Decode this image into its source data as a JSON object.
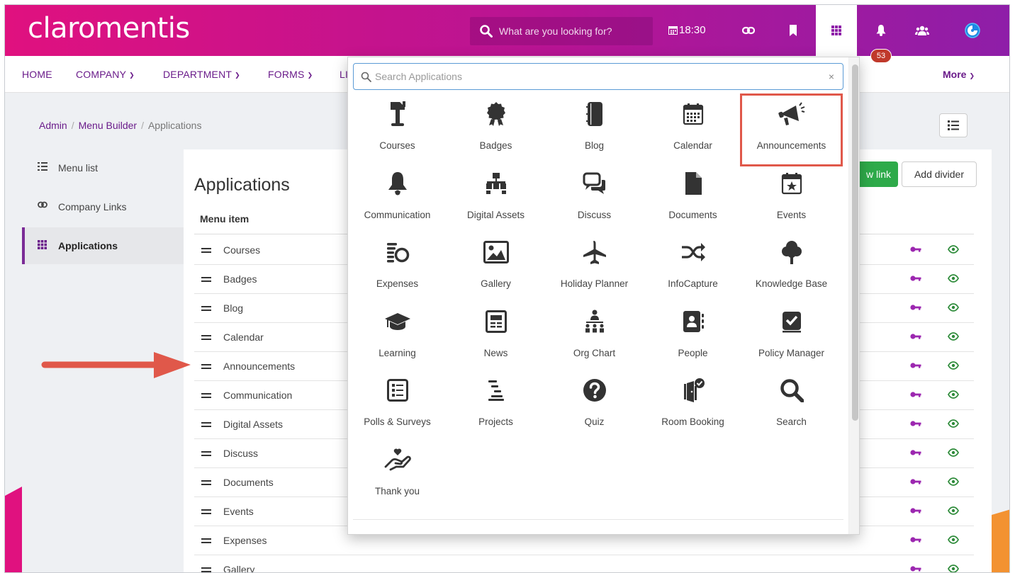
{
  "logo": "claromentis",
  "global_search": {
    "placeholder": "What are you looking for?"
  },
  "clock": "18:30",
  "notification_count": "53",
  "nav": {
    "items": [
      "HOME",
      "COMPANY",
      "DEPARTMENT",
      "FORMS",
      "LI"
    ],
    "more": "More"
  },
  "breadcrumb": [
    "Admin",
    "Menu Builder",
    "Applications"
  ],
  "sidebar": {
    "items": [
      {
        "label": "Menu list",
        "icon": "list-icon"
      },
      {
        "label": "Company Links",
        "icon": "link-icon"
      },
      {
        "label": "Applications",
        "icon": "grid-icon",
        "active": true
      }
    ]
  },
  "main": {
    "title": "Applications",
    "column_header": "Menu item",
    "new_link_label": "w link",
    "add_divider_label": "Add divider",
    "rows": [
      "Courses",
      "Badges",
      "Blog",
      "Calendar",
      "Announcements",
      "Communication",
      "Digital Assets",
      "Discuss",
      "Documents",
      "Events",
      "Expenses",
      "Gallery"
    ]
  },
  "dropdown": {
    "search_placeholder": "Search Applications",
    "clear": "×",
    "apps": [
      {
        "label": "Courses",
        "icon": "lectern-icon"
      },
      {
        "label": "Badges",
        "icon": "award-icon"
      },
      {
        "label": "Blog",
        "icon": "notebook-icon"
      },
      {
        "label": "Calendar",
        "icon": "calendar-icon"
      },
      {
        "label": "Announcements",
        "icon": "megaphone-icon",
        "highlighted": true
      },
      {
        "label": "Communication",
        "icon": "bell-icon"
      },
      {
        "label": "Digital Assets",
        "icon": "sitemap-icon"
      },
      {
        "label": "Discuss",
        "icon": "chat-bubbles-icon"
      },
      {
        "label": "Documents",
        "icon": "file-icon"
      },
      {
        "label": "Events",
        "icon": "calendar-star-icon"
      },
      {
        "label": "Expenses",
        "icon": "coins-icon"
      },
      {
        "label": "Gallery",
        "icon": "image-icon"
      },
      {
        "label": "Holiday Planner",
        "icon": "plane-icon"
      },
      {
        "label": "InfoCapture",
        "icon": "shuffle-icon"
      },
      {
        "label": "Knowledge Base",
        "icon": "tree-icon"
      },
      {
        "label": "Learning",
        "icon": "graduation-cap-icon"
      },
      {
        "label": "News",
        "icon": "newspaper-icon"
      },
      {
        "label": "Org Chart",
        "icon": "org-chart-icon"
      },
      {
        "label": "People",
        "icon": "address-book-icon"
      },
      {
        "label": "Policy Manager",
        "icon": "check-square-icon"
      },
      {
        "label": "Polls & Surveys",
        "icon": "poll-icon"
      },
      {
        "label": "Projects",
        "icon": "stream-icon"
      },
      {
        "label": "Quiz",
        "icon": "question-circle-icon"
      },
      {
        "label": "Room Booking",
        "icon": "door-check-icon"
      },
      {
        "label": "Search",
        "icon": "search-icon"
      },
      {
        "label": "Thank you",
        "icon": "hand-heart-icon"
      }
    ]
  },
  "colors": {
    "brand_pink": "#e0117f",
    "brand_purple": "#8e1ea8",
    "nav_text": "#6a1b8a",
    "annotation_red": "#e0584a",
    "green": "#2eaa4a"
  }
}
